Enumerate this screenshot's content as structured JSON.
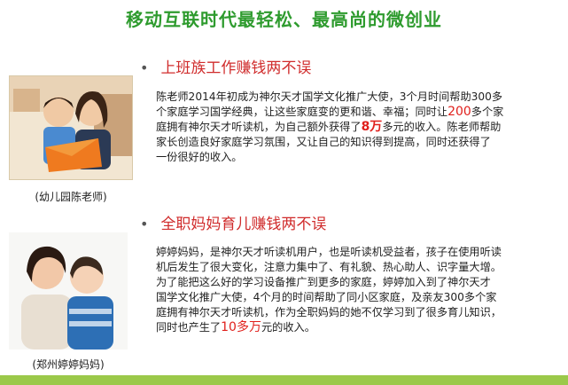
{
  "header": {
    "title": "移动互联时代最轻松、最高尚的微创业"
  },
  "section1": {
    "heading": "上班族工作赚钱两不误",
    "caption": "(幼儿园陈老师)",
    "lines": [
      [
        "陈老师2014年初成为神尔天才国学文化推广大使，3个月时间帮助300多"
      ],
      [
        "个家庭学习国学经典，让这些家庭变的更和谐、幸福；同时让",
        "200",
        "多个家"
      ],
      [
        "庭拥有神尔天才听读机，为自己额外获得了",
        "8万",
        "多元的收入。陈老师帮助"
      ],
      [
        "家长创造良好家庭学习氛围，又让自己的知识得到提高，同时还获得了"
      ],
      [
        "一份很好的收入。"
      ]
    ]
  },
  "section2": {
    "heading": "全职妈妈育儿赚钱两不误",
    "caption": "(郑州婷婷妈妈)",
    "lines": [
      [
        "婷婷妈妈，是神尔天才听读机用户，也是听读机受益者，孩子在使用听读"
      ],
      [
        "机后发生了很大变化，注意力集中了、有礼貌、热心助人、识字量大增。"
      ],
      [
        "为了能把这么好的学习设备推广到更多的家庭，婷婷加入到了神尔天才"
      ],
      [
        "国学文化推广大使，4个月的时间帮助了同小区家庭，及亲友300多个家"
      ],
      [
        "庭拥有神尔天才听读机，作为全职妈妈的她不仅学习到了很多育儿知识，"
      ],
      [
        "同时也产生了",
        "10多万",
        "元的收入。"
      ]
    ]
  },
  "colors": {
    "title_green": "#2e9b2e",
    "heading_red": "#d02c2c",
    "highlight_red": "#e0201c",
    "footer_green": "#9bc94a"
  }
}
